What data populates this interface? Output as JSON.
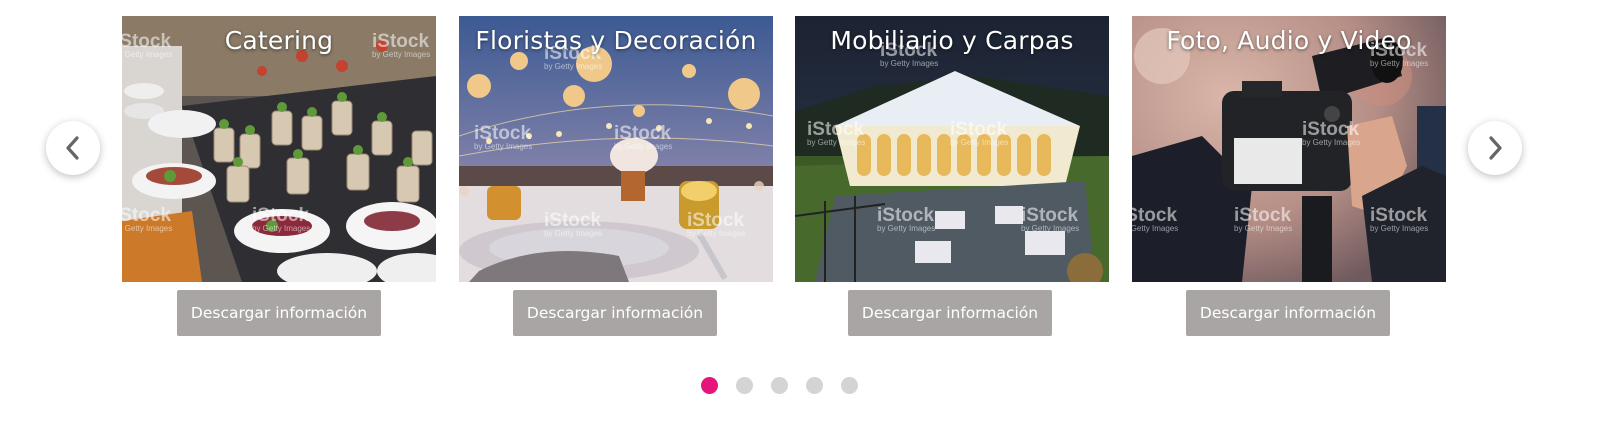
{
  "carousel": {
    "cards": [
      {
        "title": "Catering",
        "button_label": "Descargar información",
        "image": "catering-photo"
      },
      {
        "title": "Floristas y Decoración",
        "button_label": "Descargar información",
        "image": "decoration-photo"
      },
      {
        "title": "Mobiliario y Carpas",
        "button_label": "Descargar información",
        "image": "tent-photo"
      },
      {
        "title": "Foto, Audio y Video",
        "button_label": "Descargar información",
        "image": "camera-photo"
      }
    ],
    "watermark": {
      "brand": "iStock",
      "sub": "by Getty Images"
    },
    "prev_icon": "chevron-left-icon",
    "next_icon": "chevron-right-icon",
    "pagination": {
      "total": 5,
      "active_index": 0
    },
    "colors": {
      "accent": "#e5157c",
      "button": "#aaa5a5",
      "dot": "#d5d3d3"
    }
  }
}
